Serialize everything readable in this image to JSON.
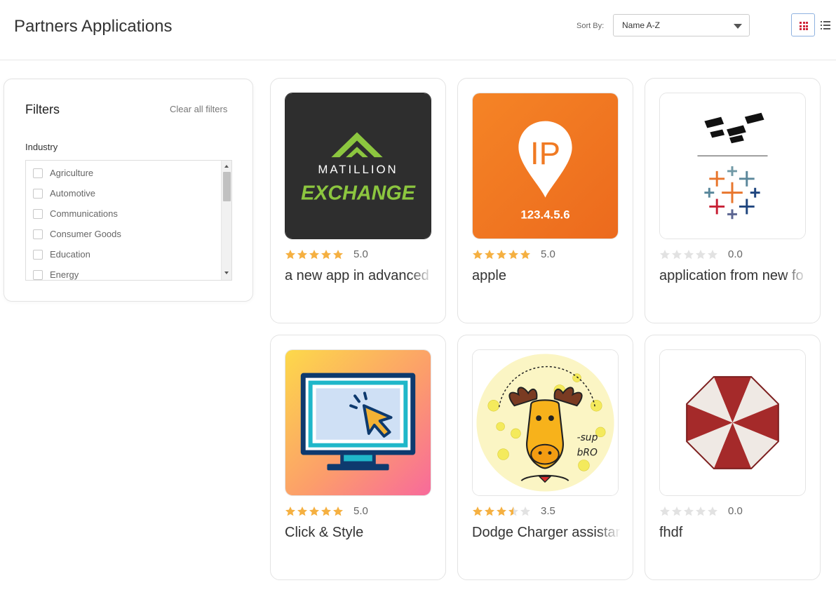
{
  "header": {
    "title": "Partners Applications",
    "sort_label": "Sort By:",
    "sort_value": "Name A-Z",
    "grid_view_icon": "grid-view-icon",
    "list_view_icon": "list-view-icon",
    "accent_color": "#d0263a"
  },
  "filters": {
    "title": "Filters",
    "clear_label": "Clear all filters",
    "industry_label": "Industry",
    "industry_options": [
      "Agriculture",
      "Automotive",
      "Communications",
      "Consumer Goods",
      "Education",
      "Energy"
    ]
  },
  "apps": [
    {
      "name": "a new app in advanced f",
      "rating": "5.0",
      "rating_value": 5.0,
      "logo_text": [
        "MATILLION",
        "EXCHANGE"
      ]
    },
    {
      "name": "apple",
      "rating": "5.0",
      "rating_value": 5.0,
      "logo_text": [
        "IP",
        "123.4.5.6"
      ]
    },
    {
      "name": "application from new fo",
      "rating": "0.0",
      "rating_value": 0
    },
    {
      "name": "Click & Style",
      "rating": "5.0",
      "rating_value": 5.0
    },
    {
      "name": "Dodge Charger assistar",
      "rating": "3.5",
      "rating_value": 3.5
    },
    {
      "name": "fhdf",
      "rating": "0.0",
      "rating_value": 0
    }
  ],
  "colors": {
    "star_filled": "#f5b041",
    "star_empty": "#e2e2e2"
  }
}
